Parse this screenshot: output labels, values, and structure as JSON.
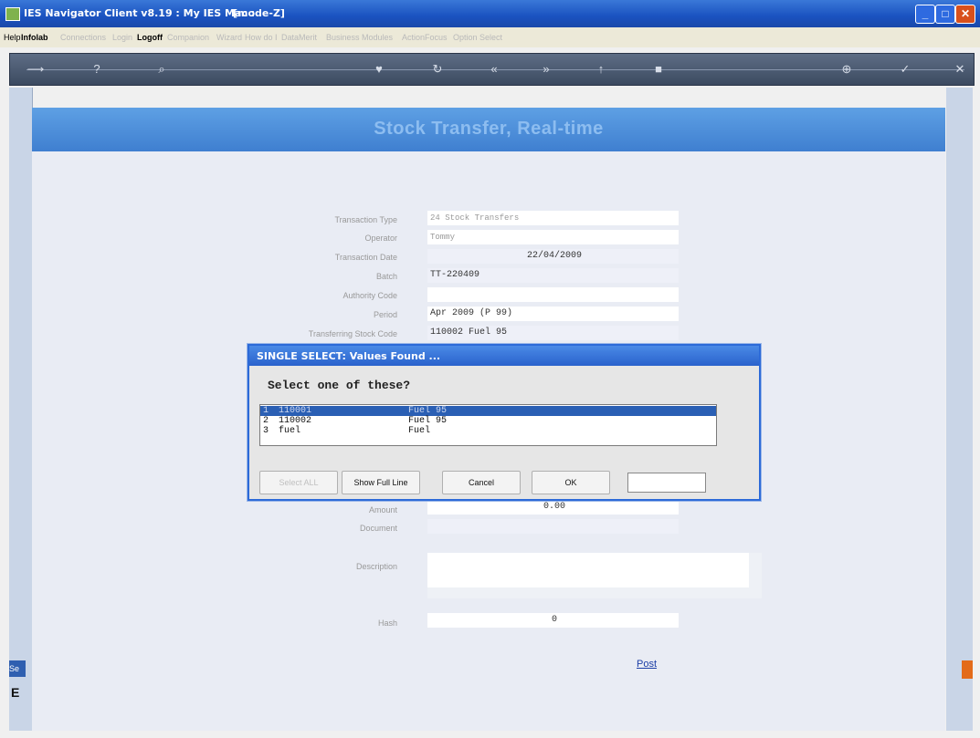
{
  "titlebar": {
    "title": "IES Navigator Client v8.19 : My IES  Mac :",
    "mode": "[mode-Z]",
    "minimize": "_",
    "maximize": "□",
    "close": "✕"
  },
  "menu": [
    {
      "label": "Help",
      "on": true
    },
    {
      "label": "Infolab",
      "bold": true
    },
    {
      "label": "Connections"
    },
    {
      "label": "Login"
    },
    {
      "label": "Logoff",
      "bold": true
    },
    {
      "label": "Companion"
    },
    {
      "label": "Wizard"
    },
    {
      "label": "How do I"
    },
    {
      "label": "DataMerit"
    },
    {
      "label": "Business Modules"
    },
    {
      "label": "ActionFocus"
    },
    {
      "label": "Option Select"
    }
  ],
  "toolbar": {
    "icons": [
      "arrow-icon",
      "help-icon",
      "search-icon",
      "heart-icon",
      "refresh-icon",
      "back-icon",
      "forward-icon",
      "up-icon",
      "stop-icon",
      "plus-icon",
      "check-icon",
      "cancel-icon"
    ],
    "glyphs": [
      "⟶",
      "?",
      "⌕",
      "♥",
      "↻",
      "«",
      "»",
      "↑",
      "■",
      "⊕",
      "✓",
      "✕"
    ]
  },
  "banner": {
    "title": "Stock Transfer, Real-time"
  },
  "form": {
    "fields": [
      {
        "label": "Transaction Type",
        "value": "24 Stock Transfers"
      },
      {
        "label": "Operator",
        "value": "Tommy"
      },
      {
        "label": "Transaction Date",
        "value": "22/04/2009"
      },
      {
        "label": "Batch",
        "value": "TT-220409"
      },
      {
        "label": "Authority Code",
        "value": ""
      },
      {
        "label": "Period",
        "value": "Apr 2009 (P 99)"
      },
      {
        "label": "Transferring Stock Code",
        "value": "110002 Fuel 95"
      }
    ],
    "amount": {
      "label": "Amount",
      "value": "0.00"
    },
    "document": {
      "label": "Document",
      "value": ""
    },
    "description": {
      "label": "Description"
    },
    "hash": {
      "label": "Hash",
      "value": "0"
    },
    "post": "Post"
  },
  "dialog": {
    "title": "SINGLE SELECT: Values Found ...",
    "question": "Select one of these?",
    "rows": [
      {
        "n": "1",
        "code": "110001",
        "desc": "Fuel 95"
      },
      {
        "n": "2",
        "code": "110002",
        "desc": "Fuel 95"
      },
      {
        "n": "3",
        "code": "fuel",
        "desc": "Fuel"
      }
    ],
    "buttons": {
      "select_all": "Select ALL",
      "show_full": "Show Full Line",
      "cancel": "Cancel",
      "ok": "OK"
    }
  },
  "side": {
    "tab": "Se",
    "letter": "E"
  }
}
